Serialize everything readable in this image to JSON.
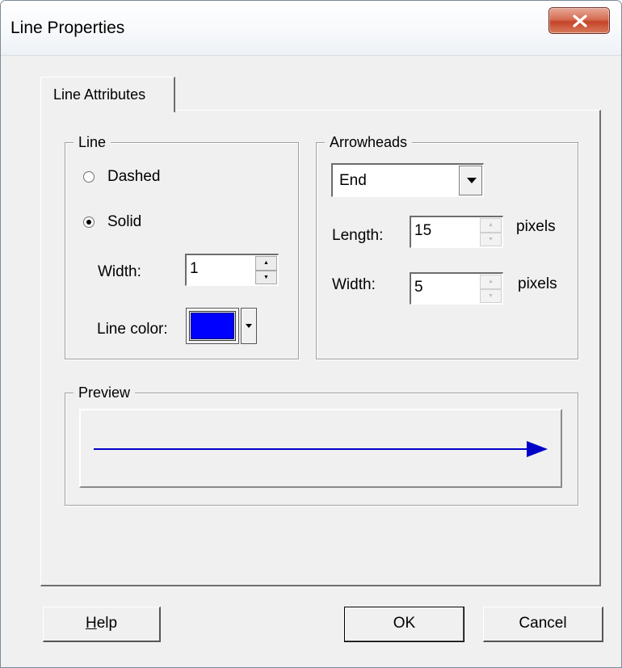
{
  "window": {
    "title": "Line Properties",
    "close_icon": "close-x-icon"
  },
  "tabs": [
    {
      "label": "Line Attributes",
      "active": true
    }
  ],
  "line_group": {
    "legend": "Line",
    "style_options": [
      {
        "label": "Dashed",
        "checked": false
      },
      {
        "label": "Solid",
        "checked": true
      }
    ],
    "width_label": "Width:",
    "width_value": "1",
    "color_label": "Line color:",
    "color": "#0000ff"
  },
  "arrowheads_group": {
    "legend": "Arrowheads",
    "position_selected": "End",
    "length_label": "Length:",
    "length_value": "15",
    "length_unit": "pixels",
    "width_label": "Width:",
    "width_value": "5",
    "width_unit": "pixels"
  },
  "preview_group": {
    "legend": "Preview",
    "line_color": "#0000c8"
  },
  "buttons": {
    "help_mnemonic": "H",
    "help_rest": "elp",
    "ok": "OK",
    "cancel": "Cancel"
  }
}
